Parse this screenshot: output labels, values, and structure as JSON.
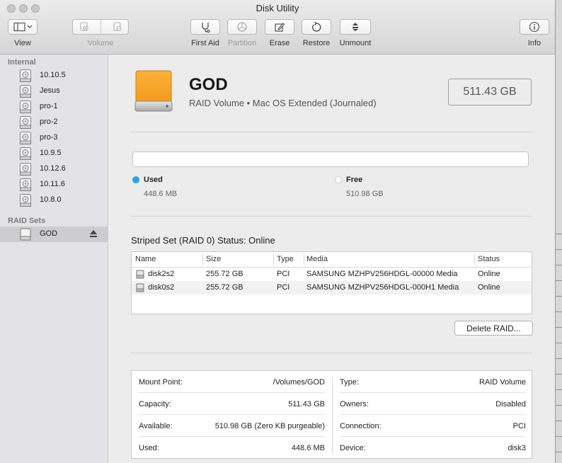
{
  "window": {
    "title": "Disk Utility"
  },
  "toolbar": {
    "view": "View",
    "volume": "Volume",
    "first_aid": "First Aid",
    "partition": "Partition",
    "erase": "Erase",
    "restore": "Restore",
    "unmount": "Unmount",
    "info": "Info"
  },
  "sidebar": {
    "internal_header": "Internal",
    "internal_items": [
      "10.10.5",
      "Jesus",
      "pro-1",
      "pro-2",
      "pro-3",
      "10.9.5",
      "10.12.6",
      "10.11.6",
      "10.8.0"
    ],
    "raid_header": "RAID Sets",
    "raid_items": [
      "GOD"
    ]
  },
  "volume": {
    "name": "GOD",
    "subtitle": "RAID Volume • Mac OS Extended (Journaled)",
    "size": "511.43 GB"
  },
  "usage": {
    "used_label": "Used",
    "used_value": "448.6 MB",
    "free_label": "Free",
    "free_value": "510.98 GB",
    "used_color": "#2ea3e6"
  },
  "raid": {
    "status_title": "Striped Set (RAID 0) Status: Online",
    "columns": [
      "Name",
      "Size",
      "Type",
      "Media",
      "Status"
    ],
    "rows": [
      {
        "name": "disk2s2",
        "size": "255.72 GB",
        "type": "PCI",
        "media": "SAMSUNG MZHPV256HDGL-00000 Media",
        "status": "Online"
      },
      {
        "name": "disk0s2",
        "size": "255.72 GB",
        "type": "PCI",
        "media": "SAMSUNG MZHPV256HDGL-000H1 Media",
        "status": "Online"
      }
    ],
    "delete_button": "Delete RAID..."
  },
  "info": {
    "left": [
      {
        "key": "Mount Point:",
        "value": "/Volumes/GOD"
      },
      {
        "key": "Capacity:",
        "value": "511.43 GB"
      },
      {
        "key": "Available:",
        "value": "510.98 GB (Zero KB purgeable)"
      },
      {
        "key": "Used:",
        "value": "448.6 MB"
      }
    ],
    "right": [
      {
        "key": "Type:",
        "value": "RAID Volume"
      },
      {
        "key": "Owners:",
        "value": "Disabled"
      },
      {
        "key": "Connection:",
        "value": "PCI"
      },
      {
        "key": "Device:",
        "value": "disk3"
      }
    ]
  }
}
